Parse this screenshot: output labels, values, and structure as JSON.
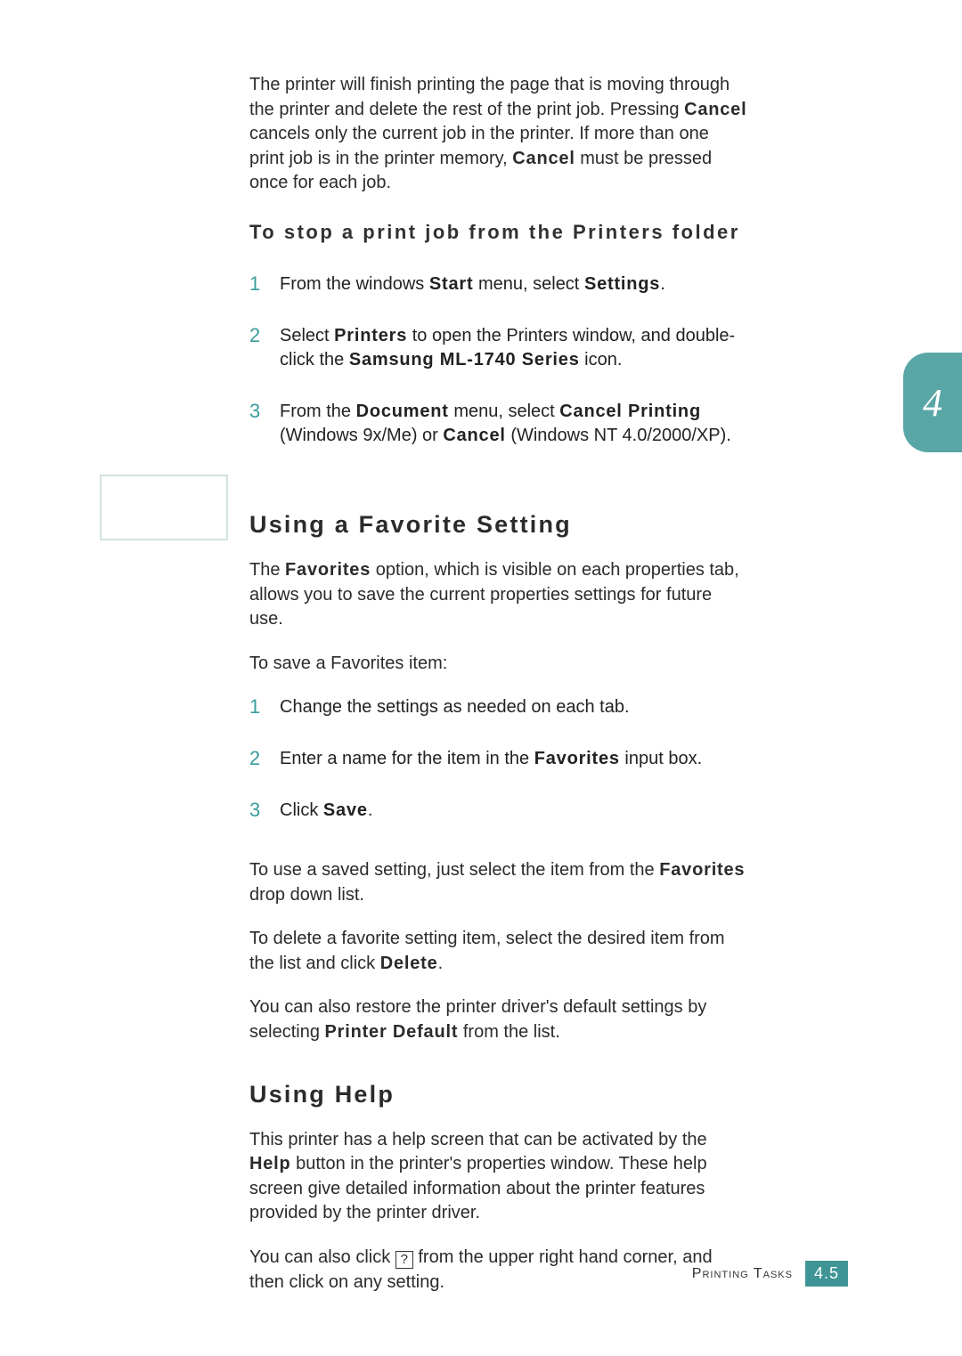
{
  "intro": {
    "p1_a": "The printer will finish printing the page that is moving through the printer and delete the rest of the print job. Pressing ",
    "p1_b": "Cancel",
    "p1_c": " cancels only the current job in the printer. If more than one print job is in the printer memory, ",
    "p1_d": "Cancel",
    "p1_e": " must be pressed once for each job."
  },
  "sub1": "To stop a print job from the Printers folder",
  "steps1": {
    "s1_a": "From the windows ",
    "s1_b": "Start",
    "s1_c": " menu, select ",
    "s1_d": "Settings",
    "s1_e": ".",
    "s2_a": "Select ",
    "s2_b": "Printers",
    "s2_c": " to open the Printers window, and double-click the ",
    "s2_d": "Samsung ML-1740 Series",
    "s2_e": " icon.",
    "s3_a": "From the ",
    "s3_b": "Document",
    "s3_c": " menu, select ",
    "s3_d": "Cancel Printing",
    "s3_e": " (Windows 9x/Me) or ",
    "s3_f": "Cancel",
    "s3_g": " (Windows NT 4.0/2000/XP)."
  },
  "fav": {
    "heading": "Using a Favorite Setting",
    "p1_a": "The ",
    "p1_b": "Favorites",
    "p1_c": " option, which is visible on each properties tab, allows you to save the current properties settings for future use.",
    "p2": "To save a Favorites item:",
    "steps": {
      "s1": "Change the settings as needed on each tab.",
      "s2_a": "Enter a name for the item in the ",
      "s2_b": "Favorites",
      "s2_c": " input box.",
      "s3_a": "Click ",
      "s3_b": "Save",
      "s3_c": "."
    },
    "p3_a": "To use a saved setting, just select the item from the ",
    "p3_b": "Favorites",
    "p3_c": " drop down list.",
    "p4_a": "To delete a favorite setting item, select the desired item from the list and click ",
    "p4_b": "Delete",
    "p4_c": ".",
    "p5_a": "You can also restore the printer driver's default settings by selecting ",
    "p5_b": "Printer Default",
    "p5_c": " from the list."
  },
  "help": {
    "heading": "Using Help",
    "p1_a": "This printer has a help screen that can be activated by the ",
    "p1_b": "Help",
    "p1_c": " button in the printer's properties window. These help screen give detailed information about the printer features provided by the printer driver.",
    "p2_a": "You can also click ",
    "p2_q": "?",
    "p2_b": " from the upper right hand corner, and then click on any setting."
  },
  "chapter": "4",
  "footer": {
    "label": "Printing Tasks",
    "page": "4.5"
  }
}
